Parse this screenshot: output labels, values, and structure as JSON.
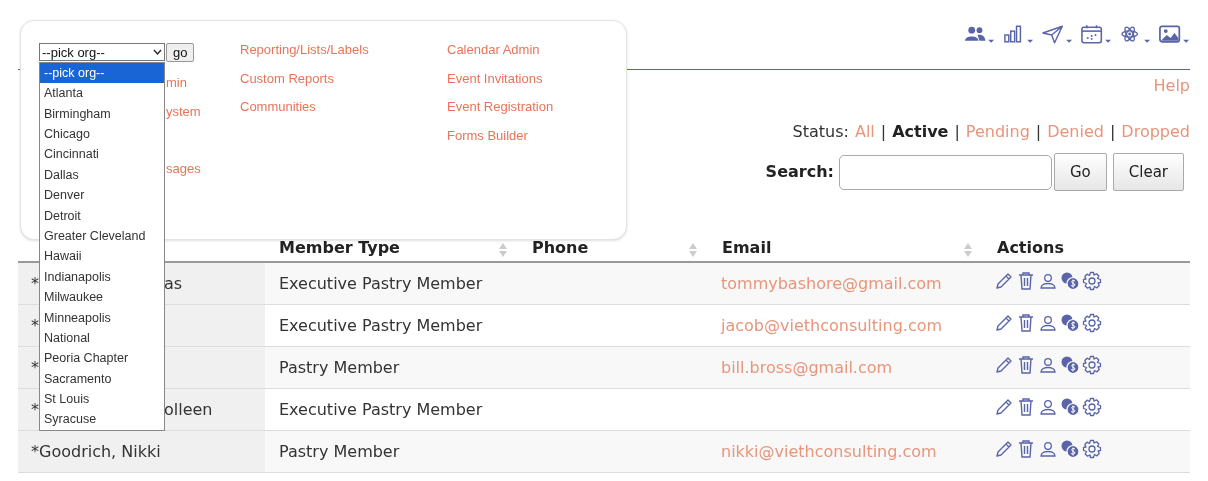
{
  "menu_panel": {
    "org_select": {
      "value": "--pick org--",
      "button": "go",
      "options": [
        {
          "label": "--pick org--",
          "selected": true
        },
        {
          "label": "Atlanta",
          "selected": false
        },
        {
          "label": "Birmingham",
          "selected": false
        },
        {
          "label": "Chicago",
          "selected": false
        },
        {
          "label": "Cincinnati",
          "selected": false
        },
        {
          "label": "Dallas",
          "selected": false
        },
        {
          "label": "Denver",
          "selected": false
        },
        {
          "label": "Detroit",
          "selected": false
        },
        {
          "label": "Greater Cleveland",
          "selected": false
        },
        {
          "label": "Hawaii",
          "selected": false
        },
        {
          "label": "Indianapolis",
          "selected": false
        },
        {
          "label": "Milwaukee",
          "selected": false
        },
        {
          "label": "Minneapolis",
          "selected": false
        },
        {
          "label": "National",
          "selected": false
        },
        {
          "label": "Peoria Chapter",
          "selected": false
        },
        {
          "label": "Sacramento",
          "selected": false
        },
        {
          "label": "St Louis",
          "selected": false
        },
        {
          "label": "Syracuse",
          "selected": false
        }
      ]
    },
    "columns": [
      [
        "min",
        "ystem",
        "sages"
      ],
      [
        "Reporting/Lists/Labels",
        "Custom Reports",
        "Communities"
      ],
      [
        "Calendar Admin",
        "Event Invitations",
        "Event Registration",
        "Forms Builder"
      ]
    ]
  },
  "help_link": "Help",
  "status_filter": {
    "label": "Status:",
    "separator": "|",
    "options": [
      {
        "label": "All",
        "selected": false
      },
      {
        "label": "Active",
        "selected": true
      },
      {
        "label": "Pending",
        "selected": false
      },
      {
        "label": "Denied",
        "selected": false
      },
      {
        "label": "Dropped",
        "selected": false
      }
    ]
  },
  "search": {
    "label": "Search:",
    "buttons": [
      "Go",
      "Clear"
    ]
  },
  "table": {
    "columns": [
      {
        "label": "Member Type",
        "sortable": true
      },
      {
        "label": "Phone",
        "sortable": true
      },
      {
        "label": "Email",
        "sortable": true
      },
      {
        "label": "Actions",
        "sortable": false
      }
    ],
    "rows": [
      {
        "name": {
          "start": "*",
          "end": "as"
        },
        "member_type": "Executive Pastry Member",
        "email": "tommybashore@gmail.com"
      },
      {
        "name": {
          "start": "*"
        },
        "member_type": "Executive Pastry Member",
        "email": "jacob@viethconsulting.com"
      },
      {
        "name": {
          "start": "*"
        },
        "member_type": "Pastry Member",
        "email": "bill.bross@gmail.com"
      },
      {
        "name": {
          "start": "*",
          "end": "olleen"
        },
        "member_type": "Executive Pastry Member"
      },
      {
        "name": {
          "start": "*Goodrich, Nikki"
        },
        "member_type": "Pastry Member",
        "email": "nikki@viethconsulting.com"
      }
    ]
  }
}
